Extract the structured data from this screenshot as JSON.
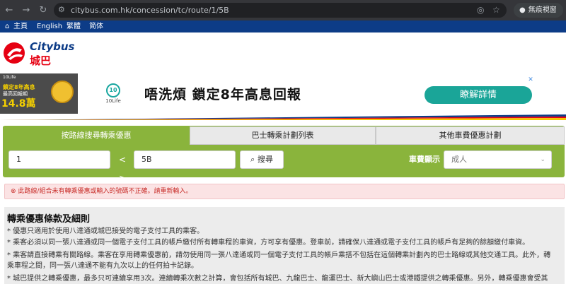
{
  "browser": {
    "url": "citybus.com.hk/concession/tc/route/1/5B",
    "profile_label": "無痕視窗"
  },
  "topnav": {
    "items": [
      {
        "label": "主頁"
      },
      {
        "label": "English"
      },
      {
        "label": "繁體"
      },
      {
        "label": "简体"
      }
    ]
  },
  "brand": {
    "name_en": "Citybus",
    "name_zh": "城巴",
    "color": "#e60012"
  },
  "ad": {
    "left_small": "10Life",
    "left_line1": "鎖定8年高息",
    "left_line2": "最高回報期",
    "left_amount": "14.8萬",
    "logo_text": "10Life",
    "headline": "唔洗煩 鎖定8年高息回報",
    "cta": "瞭解詳情"
  },
  "tabs": [
    {
      "label": "按路線搜尋轉乘優惠"
    },
    {
      "label": "巴士轉乘計劃列表"
    },
    {
      "label": "其他車費優惠計劃"
    }
  ],
  "search": {
    "route_from": "1",
    "route_to": "5B",
    "swap_symbol": "< >",
    "search_label": "搜尋",
    "fare_label": "車費顯示",
    "fare_value": "成人"
  },
  "error": {
    "message": "此路線/組合未有轉乘優惠或輸入的號碼不正確。請重新輸入。"
  },
  "terms": {
    "title": "轉乘優惠條款及細則",
    "lines": [
      "* 優惠只適用於使用八達通或城巴接受的電子支付工具的乘客。",
      "* 乘客必須以同一張八達通或同一個電子支付工具的帳戶繳付所有轉車程的車資，方可享有優惠。登車前，請確保八達通或電子支付工具的帳戶有足夠的餘額繳付車資。",
      "* 乘客請直接轉乘有關路線。乘客在享用轉乘優惠前，請勿使用同一張八達通或同一個電子支付工具的帳戶乘搭不包括在這個轉乘計劃內的巴士路線或其他交通工具。此外，轉",
      "乘車程之間，同一張八達通不能有九次以上的任何拍卡記錄。",
      "* 城巴提供之轉乘優惠，最多只可連續享用3次。連續轉乘次數之計算，會包括所有城巴、九龍巴士、龍運巴士、新大嶼山巴士或港鐵提供之轉乘優惠。另外，轉乘優惠會受其"
    ]
  },
  "colors": {
    "accent_green": "#8ab43c",
    "nav_blue": "#0d3c87",
    "cta_teal": "#1aa598",
    "error_red": "#c9302c"
  }
}
